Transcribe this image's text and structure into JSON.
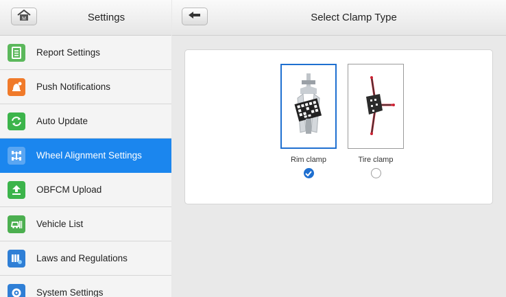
{
  "left_panel": {
    "title": "Settings",
    "home_icon": "home-icon",
    "menu": [
      {
        "label": "Report Settings",
        "icon": "report-icon",
        "color": "#5cb85c"
      },
      {
        "label": "Push Notifications",
        "icon": "bell-icon",
        "color": "#f07a2a"
      },
      {
        "label": "Auto Update",
        "icon": "refresh-icon",
        "color": "#3cb44b"
      },
      {
        "label": "Wheel Alignment Settings",
        "icon": "wheel-alignment-icon",
        "color": "#ffffff",
        "active": true
      },
      {
        "label": "OBFCM Upload",
        "icon": "upload-icon",
        "color": "#3cb44b"
      },
      {
        "label": "Vehicle List",
        "icon": "vehicle-list-icon",
        "color": "#4caf50"
      },
      {
        "label": "Laws and Regulations",
        "icon": "laws-icon",
        "color": "#2f7fd6"
      },
      {
        "label": "System Settings",
        "icon": "system-settings-icon",
        "color": "#2f7fd6"
      }
    ]
  },
  "right_panel": {
    "title": "Select Clamp Type",
    "back_icon": "back-arrow-icon",
    "options": [
      {
        "label": "Rim clamp",
        "icon": "rim-clamp-icon",
        "selected": true
      },
      {
        "label": "Tire clamp",
        "icon": "tire-clamp-icon",
        "selected": false
      }
    ]
  },
  "colors": {
    "accent": "#1b86ee",
    "radio_selected": "#1e6fd0"
  }
}
